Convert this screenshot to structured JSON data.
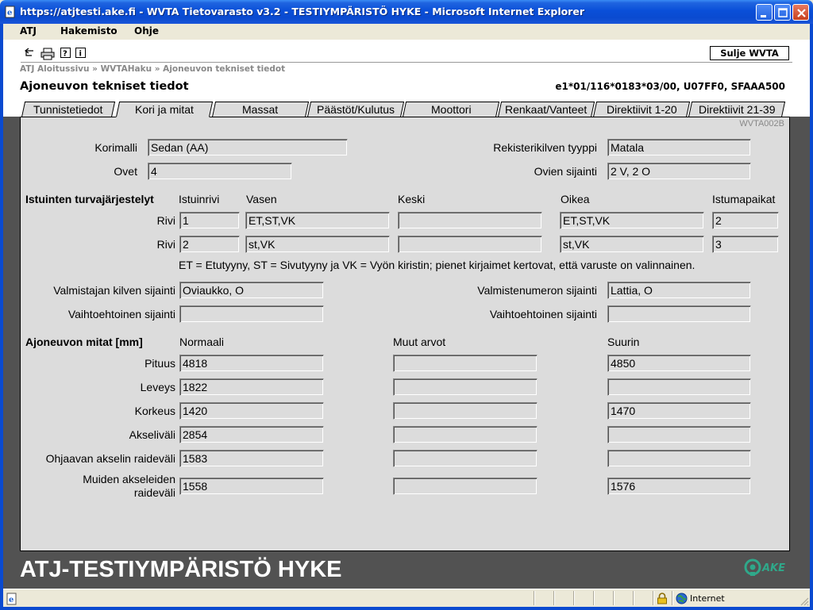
{
  "window": {
    "title": "https://atjtesti.ake.fi - WVTA Tietovarasto v3.2 - TESTIYMPÄRISTÖ HYKE - Microsoft Internet Explorer"
  },
  "menu": [
    "ATJ",
    "Hakemisto",
    "Ohje"
  ],
  "toolbar": {
    "close_button": "Sulje WVTA"
  },
  "breadcrumb": "ATJ Aloitussivu » WVTAHaku » Ajoneuvon tekniset tiedot",
  "page_title": "Ajoneuvon tekniset tiedot",
  "vehicle_id": "e1*01/116*0183*03/00, U07FF0, SFAAA500",
  "tabs": [
    "Tunnistetiedot",
    "Kori ja mitat",
    "Massat",
    "Päästöt/Kulutus",
    "Moottori",
    "Renkaat/Vanteet",
    "Direktiivit 1-20",
    "Direktiivit 21-39"
  ],
  "active_tab": "Kori ja mitat",
  "screen_code": "WVTA002B",
  "body": {
    "korimalli_label": "Korimalli",
    "korimalli": "Sedan (AA)",
    "ovet_label": "Ovet",
    "ovet": "4",
    "rekisterikilpi_label": "Rekisterikilven tyyppi",
    "rekisterikilpi": "Matala",
    "ovien_sijainti_label": "Ovien sijainti",
    "ovien_sijainti": "2 V, 2 O"
  },
  "seats": {
    "heading": "Istuinten turvajärjestelyt",
    "col_row": "Istuinrivi",
    "col_left": "Vasen",
    "col_middle": "Keski",
    "col_right": "Oikea",
    "col_seats": "Istumapaikat",
    "row_label": "Rivi",
    "rows": [
      {
        "rivi": "1",
        "vasen": "ET,ST,VK",
        "keski": "",
        "oikea": "ET,ST,VK",
        "paikat": "2"
      },
      {
        "rivi": "2",
        "vasen": "st,VK",
        "keski": "",
        "oikea": "st,VK",
        "paikat": "3"
      }
    ],
    "note": "ET = Etutyyny, ST = Sivutyyny ja VK = Vyön kiristin; pienet kirjaimet kertovat, että varuste on valinnainen."
  },
  "plates": {
    "valmistajan_label": "Valmistajan kilven sijainti",
    "valmistajan": "Oviaukko, O",
    "vaihtoehtoinen1_label": "Vaihtoehtoinen sijainti",
    "vaihtoehtoinen1": "",
    "valmistenumero_label": "Valmistenumeron sijainti",
    "valmistenumero": "Lattia, O",
    "vaihtoehtoinen2_label": "Vaihtoehtoinen sijainti",
    "vaihtoehtoinen2": ""
  },
  "dimensions": {
    "heading": "Ajoneuvon mitat [mm]",
    "col_normal": "Normaali",
    "col_other": "Muut arvot",
    "col_max": "Suurin",
    "rows": [
      {
        "label": "Pituus",
        "normal": "4818",
        "other": "",
        "max": "4850"
      },
      {
        "label": "Leveys",
        "normal": "1822",
        "other": "",
        "max": ""
      },
      {
        "label": "Korkeus",
        "normal": "1420",
        "other": "",
        "max": "1470"
      },
      {
        "label": "Akseliväli",
        "normal": "2854",
        "other": "",
        "max": ""
      },
      {
        "label": "Ohjaavan akselin raideväli",
        "normal": "1583",
        "other": "",
        "max": ""
      },
      {
        "label_line1": "Muiden akseleiden",
        "label_line2": "raideväli",
        "normal": "1558",
        "other": "",
        "max": "1576"
      }
    ]
  },
  "footer": {
    "environment": "ATJ-TESTIYMPÄRISTÖ HYKE",
    "logo_text": "AKE"
  },
  "statusbar": {
    "zone": "Internet"
  }
}
